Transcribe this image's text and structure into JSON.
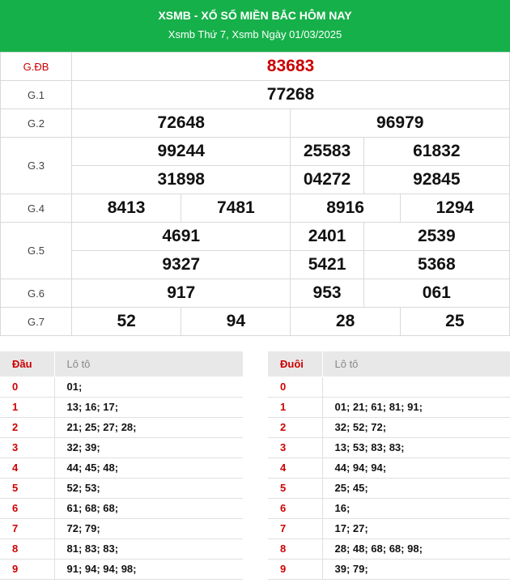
{
  "header": {
    "title": "XSMB - XỔ SỐ MIỀN BẮC HÔM NAY",
    "subtitle": "Xsmb Thứ 7, Xsmb Ngày 01/03/2025"
  },
  "results": {
    "gdb": {
      "label": "G.ĐB",
      "numbers": [
        "83683"
      ]
    },
    "g1": {
      "label": "G.1",
      "numbers": [
        "77268"
      ]
    },
    "g2": {
      "label": "G.2",
      "numbers": [
        "72648",
        "96979"
      ]
    },
    "g3": {
      "label": "G.3",
      "numbers": [
        "99244",
        "25583",
        "61832",
        "31898",
        "04272",
        "92845"
      ]
    },
    "g4": {
      "label": "G.4",
      "numbers": [
        "8413",
        "7481",
        "8916",
        "1294"
      ]
    },
    "g5": {
      "label": "G.5",
      "numbers": [
        "4691",
        "2401",
        "2539",
        "9327",
        "5421",
        "5368"
      ]
    },
    "g6": {
      "label": "G.6",
      "numbers": [
        "917",
        "953",
        "061"
      ]
    },
    "g7": {
      "label": "G.7",
      "numbers": [
        "52",
        "94",
        "28",
        "25"
      ]
    }
  },
  "loto_dau": {
    "header_key": "Đầu",
    "header_val": "Lô tô",
    "rows": [
      {
        "key": "0",
        "val": "01;"
      },
      {
        "key": "1",
        "val": "13; 16; 17;"
      },
      {
        "key": "2",
        "val": "21; 25; 27; 28;"
      },
      {
        "key": "3",
        "val": "32; 39;"
      },
      {
        "key": "4",
        "val": "44; 45; 48;"
      },
      {
        "key": "5",
        "val": "52; 53;"
      },
      {
        "key": "6",
        "val": "61; 68; 68;"
      },
      {
        "key": "7",
        "val": "72; 79;"
      },
      {
        "key": "8",
        "val": "81; 83; 83;"
      },
      {
        "key": "9",
        "val": "91; 94; 94; 98;"
      }
    ]
  },
  "loto_duoi": {
    "header_key": "Đuôi",
    "header_val": "Lô tô",
    "rows": [
      {
        "key": "0",
        "val": ""
      },
      {
        "key": "1",
        "val": "01; 21; 61; 81; 91;"
      },
      {
        "key": "2",
        "val": "32; 52; 72;"
      },
      {
        "key": "3",
        "val": "13; 53; 83; 83;"
      },
      {
        "key": "4",
        "val": "44; 94; 94;"
      },
      {
        "key": "5",
        "val": "25; 45;"
      },
      {
        "key": "6",
        "val": "16;"
      },
      {
        "key": "7",
        "val": "17; 27;"
      },
      {
        "key": "8",
        "val": "28; 48; 68; 68; 98;"
      },
      {
        "key": "9",
        "val": "39; 79;"
      }
    ]
  }
}
